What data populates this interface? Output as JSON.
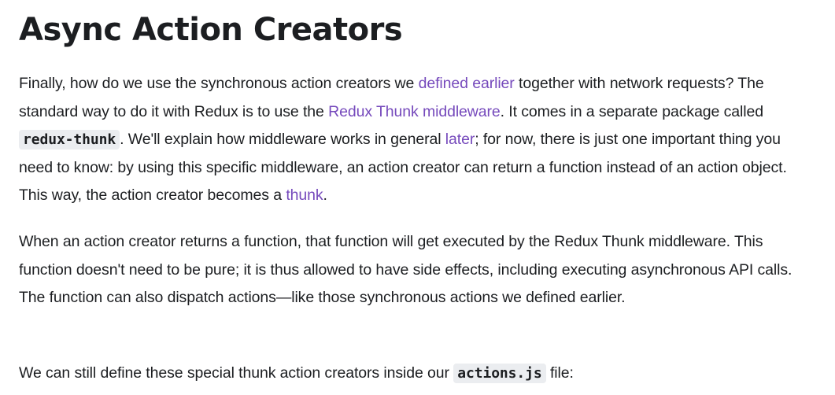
{
  "heading": "Async Action Creators",
  "p1": {
    "t1": "Finally, how do we use the synchronous action creators we ",
    "link_defined_earlier": "defined earlier",
    "t2": " together with network requests? The standard way to do it with Redux is to use the ",
    "link_redux_thunk_middleware": "Redux Thunk middleware",
    "t3": ". It comes in a separate package called ",
    "code_redux_thunk": "redux-thunk",
    "t4": ". We'll explain how middleware works in general ",
    "link_later": "later",
    "t5": "; for now, there is just one important thing you need to know: by using this specific middleware, an action creator can return a function instead of an action object. This way, the action creator becomes a ",
    "link_thunk": "thunk",
    "t6": "."
  },
  "p2": {
    "text": "When an action creator returns a function, that function will get executed by the Redux Thunk middleware. This function doesn't need to be pure; it is thus allowed to have side effects, including executing asynchronous API calls. The function can also dispatch actions—like those synchronous actions we defined earlier."
  },
  "p3": {
    "t1": "We can still define these special thunk action creators inside our ",
    "code_actions_js": "actions.js",
    "t2": " file:"
  },
  "colors": {
    "text": "#1c1e21",
    "link": "#764abc",
    "code_background": "#ebedf0"
  }
}
